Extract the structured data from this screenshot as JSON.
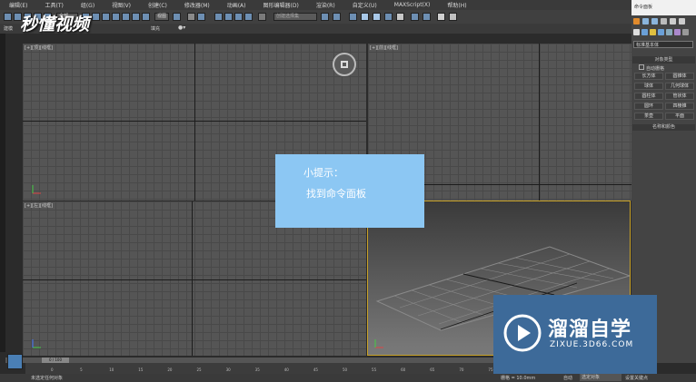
{
  "menu": [
    "编辑(E)",
    "工具(T)",
    "组(G)",
    "视图(V)",
    "创建(C)",
    "修改器(M)",
    "动画(A)",
    "图形编辑器(D)",
    "渲染(R)",
    "自定义(U)",
    "MAXScript(X)",
    "帮助(H)"
  ],
  "toolbar": {
    "filter_value": "全部",
    "view_value": "视图",
    "selection_set_placeholder": "创建选择集"
  },
  "ribbon": {
    "left_label": "建模",
    "fill_label": "填充"
  },
  "viewports": {
    "top_label": "[+][顶][线框]",
    "front_label": "[+][前][线框]",
    "left_label": "[+][左][线框]"
  },
  "command_panel": {
    "title": "命令面板",
    "category_dropdown": "标准基本体",
    "object_type_header": "对象类型",
    "autogrid_label": "自动栅格",
    "buttons": [
      "长方体",
      "圆锥体",
      "球体",
      "几何球体",
      "圆柱体",
      "管状体",
      "圆环",
      "四棱锥",
      "茶壶",
      "平面"
    ],
    "name_color_header": "名称和颜色"
  },
  "timeline": {
    "frame_counter": "0 / 100",
    "ticks": [
      "0",
      "5",
      "10",
      "15",
      "20",
      "25",
      "30",
      "35",
      "40",
      "45",
      "50",
      "55",
      "60",
      "65",
      "70",
      "75",
      "80",
      "85",
      "90",
      "95",
      "100"
    ]
  },
  "status": {
    "selection_text": "未选定任何对象",
    "grid_label": "栅格 = 10.0mm",
    "autokey_label": "自动",
    "selected_object_value": "选定对象",
    "set_key_label": "设置关键点"
  },
  "tip": {
    "title": "小提示：",
    "body": "找到命令面板"
  },
  "watermark": {
    "brand_text": "溜溜自学",
    "url": "ZIXUE.3D66.COM"
  },
  "overlay_logo": "秒懂视频",
  "colors": {
    "tip_bg": "#8cc7f3",
    "watermark_bg": "#3d6a99",
    "viewport_border_active": "#c9a227"
  }
}
